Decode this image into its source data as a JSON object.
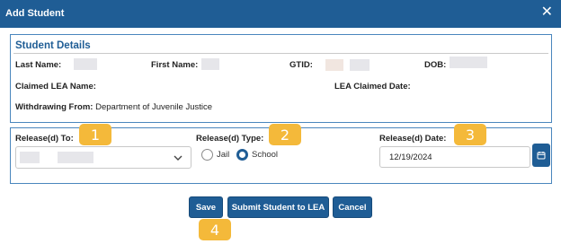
{
  "dialog": {
    "title": "Add Student",
    "close_glyph": "✕"
  },
  "student_details": {
    "heading": "Student Details",
    "last_name_label": "Last Name:",
    "first_name_label": "First Name:",
    "gtid_label": "GTID:",
    "dob_label": "DOB:",
    "claimed_lea_name_label": "Claimed LEA Name:",
    "lea_claimed_date_label": "LEA Claimed Date:",
    "withdrawing_from_label": "Withdrawing From:",
    "withdrawing_from_value": "Department of Juvenile Justice"
  },
  "release": {
    "released_to_label": "Release(d) To:",
    "released_type_label": "Release(d) Type:",
    "type_options": [
      {
        "label": "Jail",
        "selected": false
      },
      {
        "label": "School",
        "selected": true
      }
    ],
    "released_date_label": "Release(d) Date:",
    "released_date_value": "12/19/2024"
  },
  "buttons": {
    "save": "Save",
    "submit": "Submit Student to LEA",
    "cancel": "Cancel"
  },
  "callouts": [
    "1",
    "2",
    "3",
    "4"
  ],
  "icons": {
    "close": "close-icon",
    "dropdown": "chevron-down-icon",
    "calendar": "calendar-icon"
  },
  "colors": {
    "primary": "#1f5d95",
    "callout": "#f4b93a"
  }
}
